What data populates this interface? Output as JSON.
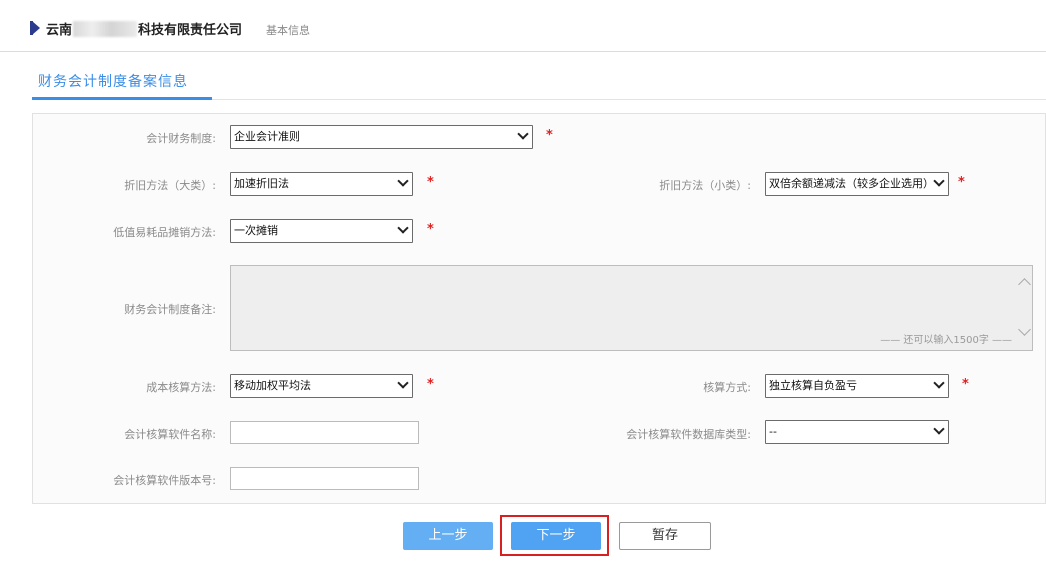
{
  "header": {
    "company_name_start": "云南",
    "company_name_end": "科技有限责任公司",
    "subtitle": "基本信息"
  },
  "tab": {
    "label": "财务会计制度备案信息"
  },
  "form": {
    "accounting_system": {
      "label": "会计财务制度:",
      "value": "企业会计准则",
      "required_mark": "*"
    },
    "depreciation_major": {
      "label": "折旧方法（大类）:",
      "value": "加速折旧法",
      "required_mark": "*"
    },
    "depreciation_minor": {
      "label": "折旧方法（小类）:",
      "value": "双倍余额递减法（较多企业选用）",
      "required_mark": "*"
    },
    "low_value_amortization": {
      "label": "低值易耗品摊销方法:",
      "value": "一次摊销",
      "required_mark": "*"
    },
    "remarks": {
      "label": "财务会计制度备注:",
      "value": "",
      "hint": "—— 还可以输入1500字 ——"
    },
    "cost_method": {
      "label": "成本核算方法:",
      "value": "移动加权平均法",
      "required_mark": "*"
    },
    "accounting_mode": {
      "label": "核算方式:",
      "value": "独立核算自负盈亏",
      "required_mark": "*"
    },
    "software_name": {
      "label": "会计核算软件名称:",
      "value": ""
    },
    "software_db_type": {
      "label": "会计核算软件数据库类型:",
      "value": "--"
    },
    "software_version": {
      "label": "会计核算软件版本号:",
      "value": ""
    }
  },
  "buttons": {
    "prev": "上一步",
    "next": "下一步",
    "save": "暂存"
  },
  "colors": {
    "accent": "#3a8ee6",
    "button_blue": "#4fa3f2",
    "required_red": "#e02020",
    "highlight_red": "#d92020"
  }
}
